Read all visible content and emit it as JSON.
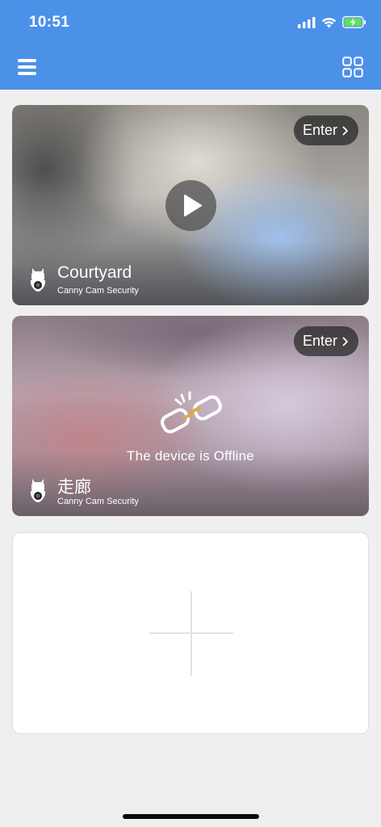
{
  "status_bar": {
    "time": "10:51",
    "icons": [
      "signal-icon",
      "wifi-icon",
      "battery-charging-icon"
    ]
  },
  "header": {
    "background_color": "#4c91e8",
    "left_icon": "menu-icon",
    "right_icon": "grid-view-icon"
  },
  "devices": [
    {
      "name": "Courtyard",
      "subtitle": "Canny Cam Security",
      "enter_label": "Enter",
      "status": "online",
      "center_icon": "play-icon"
    },
    {
      "name": "走廊",
      "subtitle": "Canny Cam Security",
      "enter_label": "Enter",
      "status": "offline",
      "center_icon": "broken-link-icon",
      "offline_message": "The device is Offline"
    }
  ],
  "add_device": {
    "icon": "plus-icon"
  }
}
